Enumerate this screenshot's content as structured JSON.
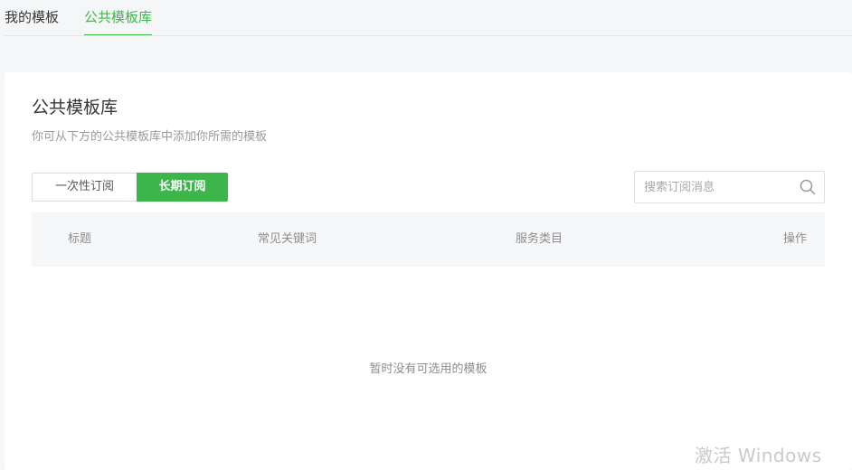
{
  "tabs": {
    "mine": "我的模板",
    "public": "公共模板库"
  },
  "panel": {
    "title": "公共模板库",
    "description": "你可从下方的公共模板库中添加你所需的模板"
  },
  "segment": {
    "one_time": "一次性订阅",
    "long_term": "长期订阅",
    "selected": "长期订阅"
  },
  "search": {
    "placeholder": "搜索订阅消息",
    "value": "",
    "icon": "search-icon"
  },
  "table": {
    "columns": [
      "标题",
      "常见关键词",
      "服务类目",
      "操作"
    ],
    "rows": [],
    "empty_text": "暂时没有可选用的模板"
  },
  "watermark": "激活 Windows",
  "colors": {
    "accent": "#3cb64a",
    "background": "#f5f6f7",
    "header_row": "#f6f7f9"
  }
}
